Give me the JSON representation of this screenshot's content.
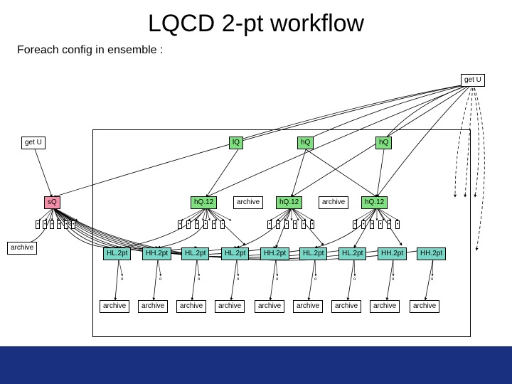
{
  "title": "LQCD 2-pt workflow",
  "subtitle": "Foreach config in ensemble :",
  "nodes": {
    "getU_top": "get U",
    "getU_left": "get U",
    "lQ": "lQ",
    "hQ": "hQ",
    "sQ": "sQ",
    "hQ12": "hQ.12",
    "archive": "archive",
    "HL2pt": "HL.2pt",
    "HH2pt": "HH.2pt"
  },
  "colors": {
    "green": "#7fe080",
    "pink": "#f58ea8",
    "teal": "#77d8c8"
  }
}
